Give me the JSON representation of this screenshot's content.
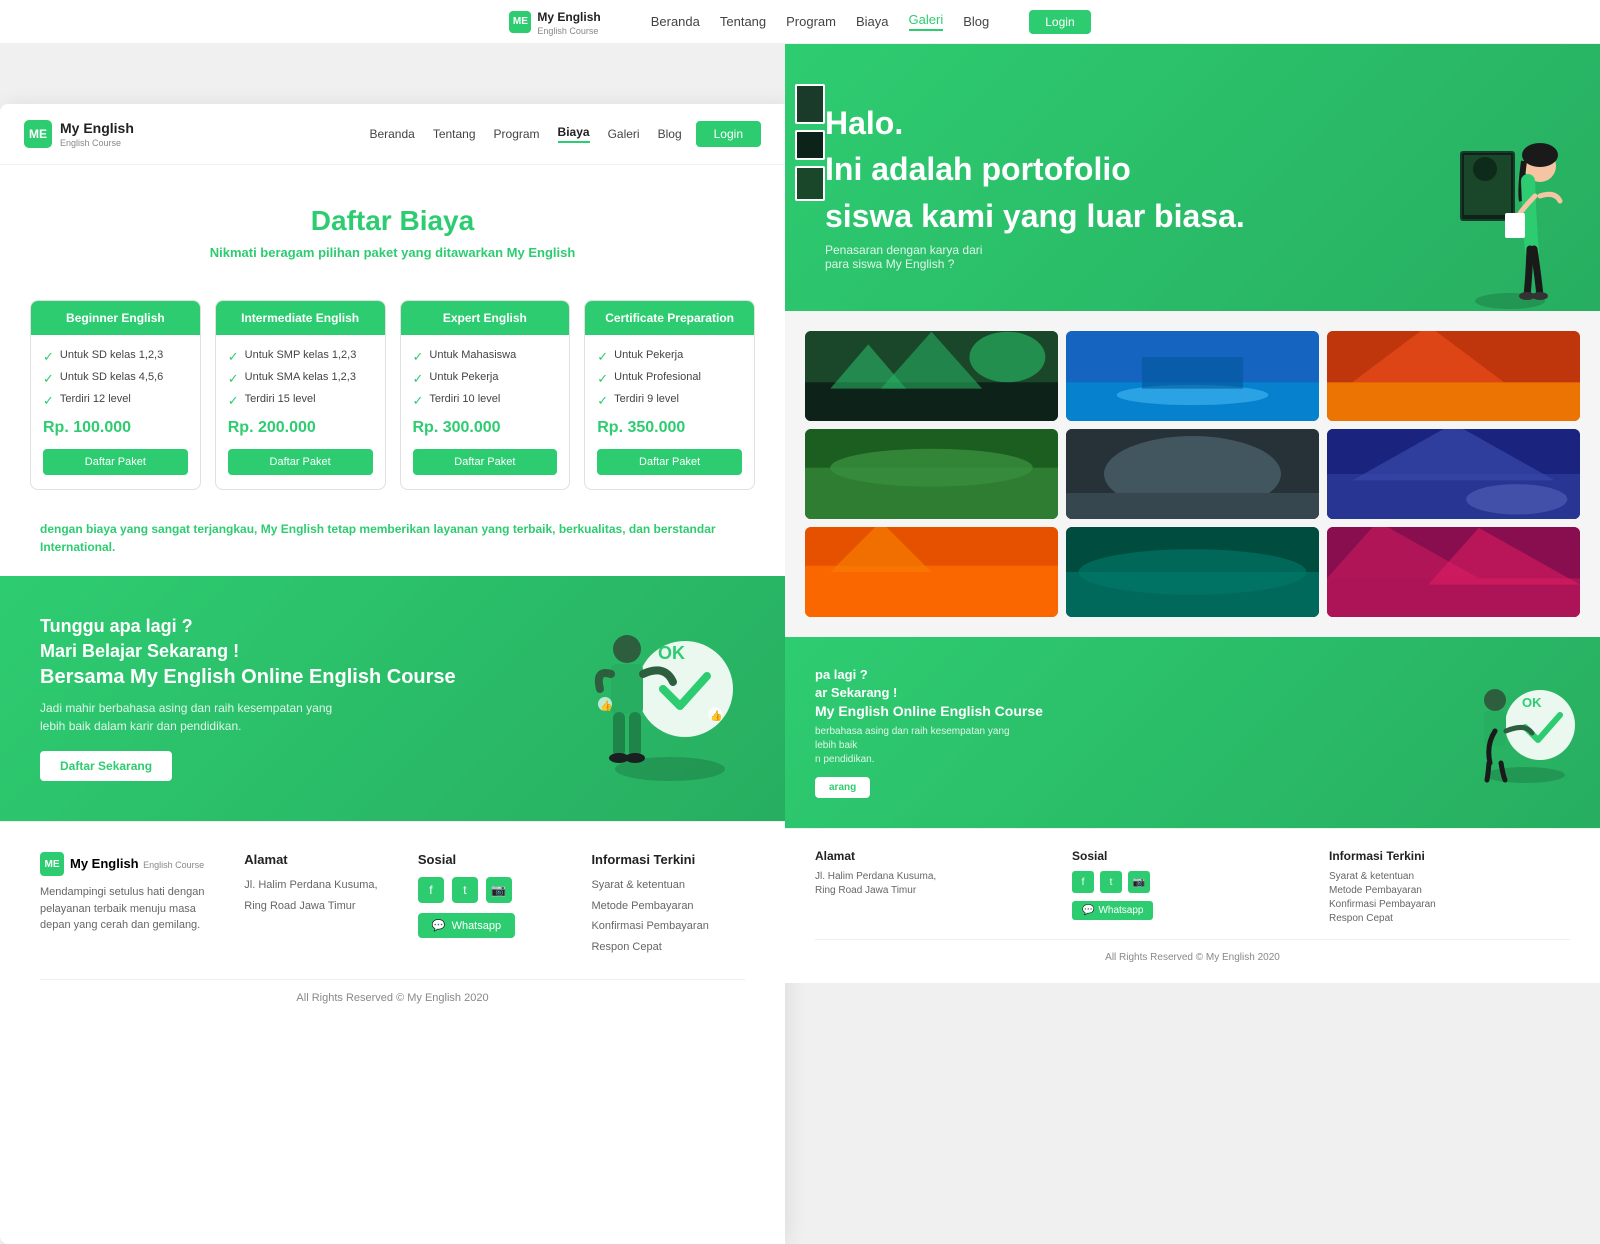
{
  "global_nav": {
    "brand_name": "My English",
    "brand_sub": "English Course",
    "links": [
      "Beranda",
      "Tentang",
      "Program",
      "Biaya",
      "Galeri",
      "Blog"
    ],
    "active_link": "Galeri",
    "login_label": "Login"
  },
  "left_nav": {
    "brand_name": "My English",
    "brand_sub": "English Course",
    "links": [
      "Beranda",
      "Tentang",
      "Program",
      "Biaya",
      "Galeri",
      "Blog"
    ],
    "active_link": "Biaya",
    "login_label": "Login"
  },
  "pricing": {
    "title": "Daftar Biaya",
    "subtitle_prefix": "Nikmati beragam pilihan paket yang ditawarkan ",
    "subtitle_brand": "My English",
    "cards": [
      {
        "header": "Beginner English",
        "features": [
          "Untuk SD kelas 1,2,3",
          "Untuk SD kelas 4,5,6",
          "Terdiri 12 level"
        ],
        "price": "Rp. 100.000",
        "button": "Daftar Paket"
      },
      {
        "header": "Intermediate English",
        "features": [
          "Untuk SMP kelas 1,2,3",
          "Untuk SMA kelas 1,2,3",
          "Terdiri 15 level"
        ],
        "price": "Rp. 200.000",
        "button": "Daftar Paket"
      },
      {
        "header": "Expert English",
        "features": [
          "Untuk Mahasiswa",
          "Untuk Pekerja",
          "Terdiri 10 level"
        ],
        "price": "Rp. 300.000",
        "button": "Daftar Paket"
      },
      {
        "header": "Certificate Preparation",
        "features": [
          "Untuk Pekerja",
          "Untuk Profesional",
          "Terdiri 9 level"
        ],
        "price": "Rp. 350.000",
        "button": "Daftar Paket"
      }
    ],
    "note_prefix": "dengan biaya yang sangat terjangkau, ",
    "note_brand": "My English",
    "note_suffix": " tetap memberikan layanan yang terbaik, berkualitas, dan berstandar International."
  },
  "cta": {
    "line1": "Tunggu apa lagi ?",
    "line2": "Mari Belajar Sekarang !",
    "line3": "Bersama My English Online English Course",
    "body": "Jadi mahir berbahasa asing dan raih kesempatan yang lebih baik dalam karir dan pendidikan.",
    "button": "Daftar Sekarang",
    "ok_label": "OK"
  },
  "footer": {
    "brand_name": "My English",
    "brand_sub": "English Course",
    "brand_desc": "Mendampingi setulus hati dengan pelayanan terbaik menuju masa depan yang cerah dan gemilang.",
    "address_title": "Alamat",
    "address_line1": "Jl. Halim Perdana Kusuma,",
    "address_line2": "Ring Road Jawa Timur",
    "social_title": "Sosial",
    "social_icons": [
      "f",
      "t",
      "i"
    ],
    "whatsapp_label": "Whatsapp",
    "info_title": "Informasi Terkini",
    "info_links": [
      "Syarat & ketentuan",
      "Metode Pembayaran",
      "Konfirmasi Pembayaran",
      "Respon Cepat"
    ],
    "copyright": "All Rights Reserved © My English 2020"
  },
  "right_hero": {
    "line1": "Halo.",
    "line2": "Ini adalah portofolio",
    "line3": "siswa kami yang luar biasa.",
    "desc": "Penasaran dengan karya dari",
    "desc2": "para siswa My English ?"
  },
  "gallery": {
    "classes": [
      "g1",
      "g2",
      "g3",
      "g4",
      "g5",
      "g6",
      "g7",
      "g8",
      "g9"
    ]
  },
  "right_cta": {
    "line1": "pa lagi ?",
    "line2": "ar Sekarang !",
    "line3": "My English Online English Course",
    "body": "berbahasa asing dan raih kesempatan yang lebih baik",
    "body2": "n pendidikan.",
    "button": "arang",
    "ok_label": "OK"
  },
  "right_footer": {
    "address_title": "Alamat",
    "address_line1": "Jl. Halim Perdana Kusuma,",
    "address_line2": "Ring Road Jawa Timur",
    "social_title": "Sosial",
    "whatsapp_label": "Whatsapp",
    "info_title": "Informasi Terkini",
    "info_links": [
      "Syarat & ketentuan",
      "Metode Pembayaran",
      "Konfirmasi Pembayaran",
      "Respon Cepat"
    ],
    "copyright": "All Rights Reserved © My English 2020"
  }
}
